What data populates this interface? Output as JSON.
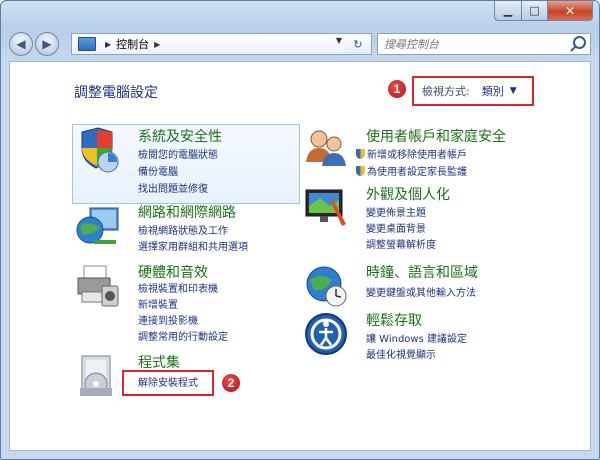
{
  "window": {
    "min_label": "▁",
    "max_label": "□",
    "close_label": "✕"
  },
  "nav": {
    "back_icon": "◀",
    "forward_icon": "▶",
    "address_text": "控制台",
    "address_sep": "▶",
    "refresh_icon": "↻",
    "search_placeholder": "搜尋控制台"
  },
  "main": {
    "page_title": "調整電腦設定",
    "viewby_label": "檢視方式:",
    "viewby_value": "類別",
    "badge1": "1",
    "badge2": "2"
  },
  "categories": {
    "security": {
      "title": "系統及安全性",
      "links": [
        "檢閱您的電腦狀態",
        "備份電腦",
        "找出問題並修復"
      ]
    },
    "network": {
      "title": "網路和網際網路",
      "links": [
        "檢視網路狀態及工作",
        "選擇家用群組和共用選項"
      ]
    },
    "hardware": {
      "title": "硬體和音效",
      "links": [
        "檢視裝置和印表機",
        "新增裝置",
        "連接到投影機",
        "調整常用的行動設定"
      ]
    },
    "programs": {
      "title": "程式集",
      "links": [
        "解除安裝程式"
      ]
    },
    "users": {
      "title": "使用者帳戶和家庭安全",
      "links": [
        "新增或移除使用者帳戶",
        "為使用者設定家長監護"
      ]
    },
    "appearance": {
      "title": "外觀及個人化",
      "links": [
        "變更佈景主題",
        "變更桌面背景",
        "調整螢幕解析度"
      ]
    },
    "clock": {
      "title": "時鐘、語言和區域",
      "links": [
        "變更鍵盤或其他輸入方法"
      ]
    },
    "ease": {
      "title": "輕鬆存取",
      "links": [
        "讓 Windows 建議設定",
        "最佳化視覺顯示"
      ]
    }
  },
  "colors": {
    "category_title": "#1b7216",
    "link": "#1e3287",
    "highlight_box": "#d9262a"
  }
}
